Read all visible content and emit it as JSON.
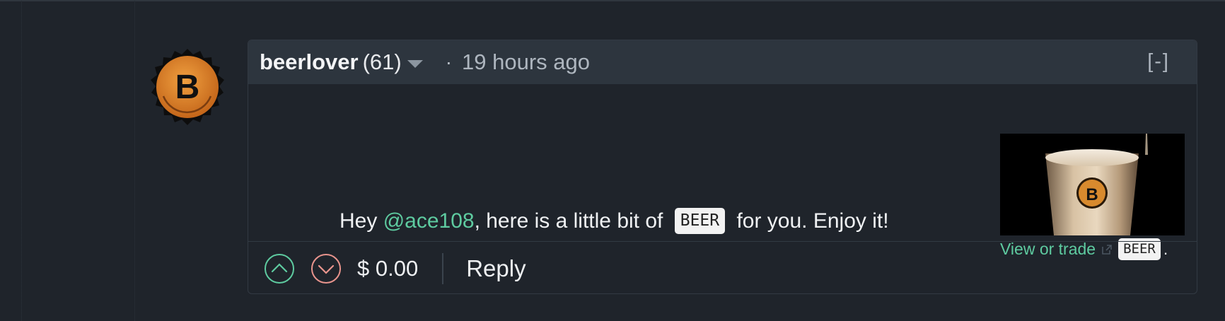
{
  "comment": {
    "author": "beerlover",
    "reputation": "(61)",
    "separator": "·",
    "timestamp": "19 hours ago",
    "collapse_label": "[-]",
    "avatar_letter": "B",
    "body": {
      "greeting": "Hey ",
      "mention": "@ace108",
      "middle": ", here is a little bit of ",
      "token": "BEER",
      "end": " for you. Enjoy it!"
    },
    "trade": {
      "link_label": "View or trade",
      "token": "BEER",
      "period": "."
    },
    "image_badge_letter": "B",
    "footer": {
      "payout": "$ 0.00",
      "reply_label": "Reply"
    }
  },
  "colors": {
    "background": "#1f242b",
    "header": "#2d353e",
    "accent_green": "#5ecba0",
    "downvote_red": "#e8948d",
    "avatar_orange": "#d9822b"
  },
  "icons": [
    "upvote-icon",
    "downvote-icon",
    "external-link-icon",
    "dropdown-caret-icon"
  ]
}
